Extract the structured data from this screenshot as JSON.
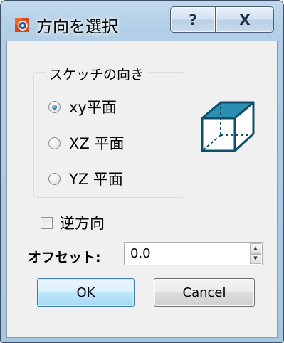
{
  "window": {
    "title": "方向を選択"
  },
  "titlebar_buttons": {
    "help": "?",
    "close": "X"
  },
  "sketch_orientation": {
    "title": "スケッチの向き",
    "options": [
      {
        "label": "xy平面",
        "checked": true
      },
      {
        "label": "XZ 平面",
        "checked": false
      },
      {
        "label": "YZ 平面",
        "checked": false
      }
    ]
  },
  "reverse": {
    "label": "逆方向",
    "checked": false
  },
  "offset": {
    "label": "オフセット:",
    "value": "0.0"
  },
  "buttons": {
    "ok": "OK",
    "cancel": "Cancel"
  },
  "colors": {
    "cube_face": "#2a8fb0",
    "cube_edge": "#0f4f6a",
    "title_bg": "#b8d2e8",
    "client_bg": "#f0f0f0"
  },
  "icons": {
    "app": "gear-app-icon",
    "preview": "cube-icon"
  }
}
